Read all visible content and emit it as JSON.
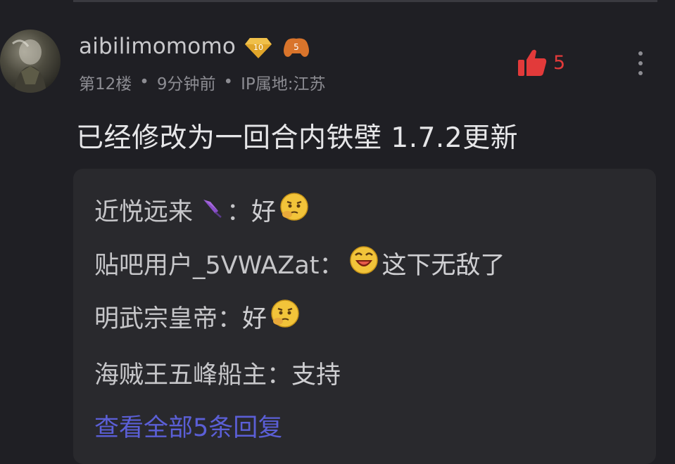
{
  "comment": {
    "username": "aibilimomomo",
    "level_badge": "10",
    "fan_badge": "5",
    "floor": "第12楼",
    "time": "9分钟前",
    "ip": "IP属地:江苏",
    "like_count": "5",
    "text": "已经修改为一回合内铁壁 1.7.2更新"
  },
  "replies": [
    {
      "name": "近悦远来",
      "sep": "：",
      "text": "好"
    },
    {
      "name": "贴吧用户_5VWAZat",
      "sep": "：",
      "text": "这下无敌了"
    },
    {
      "name": "明武宗皇帝",
      "sep": "：",
      "text": "好"
    },
    {
      "name": "海贼王五峰船主",
      "sep": "：",
      "text": "支持"
    }
  ],
  "view_all": "查看全部5条回复",
  "colors": {
    "background": "#1f1f24",
    "reply_box": "#29292d",
    "like_red": "#e23a3a",
    "link_purple": "#5b5fd6"
  },
  "icons": {
    "avatar": "user-avatar",
    "level": "diamond-level-badge",
    "fan": "gamepad-fan-badge",
    "like": "thumbs-up-icon",
    "more": "more-vertical-icon",
    "umbrella": "umbrella-icon",
    "thinking": "thinking-emoji",
    "laughing": "laughing-emoji"
  }
}
